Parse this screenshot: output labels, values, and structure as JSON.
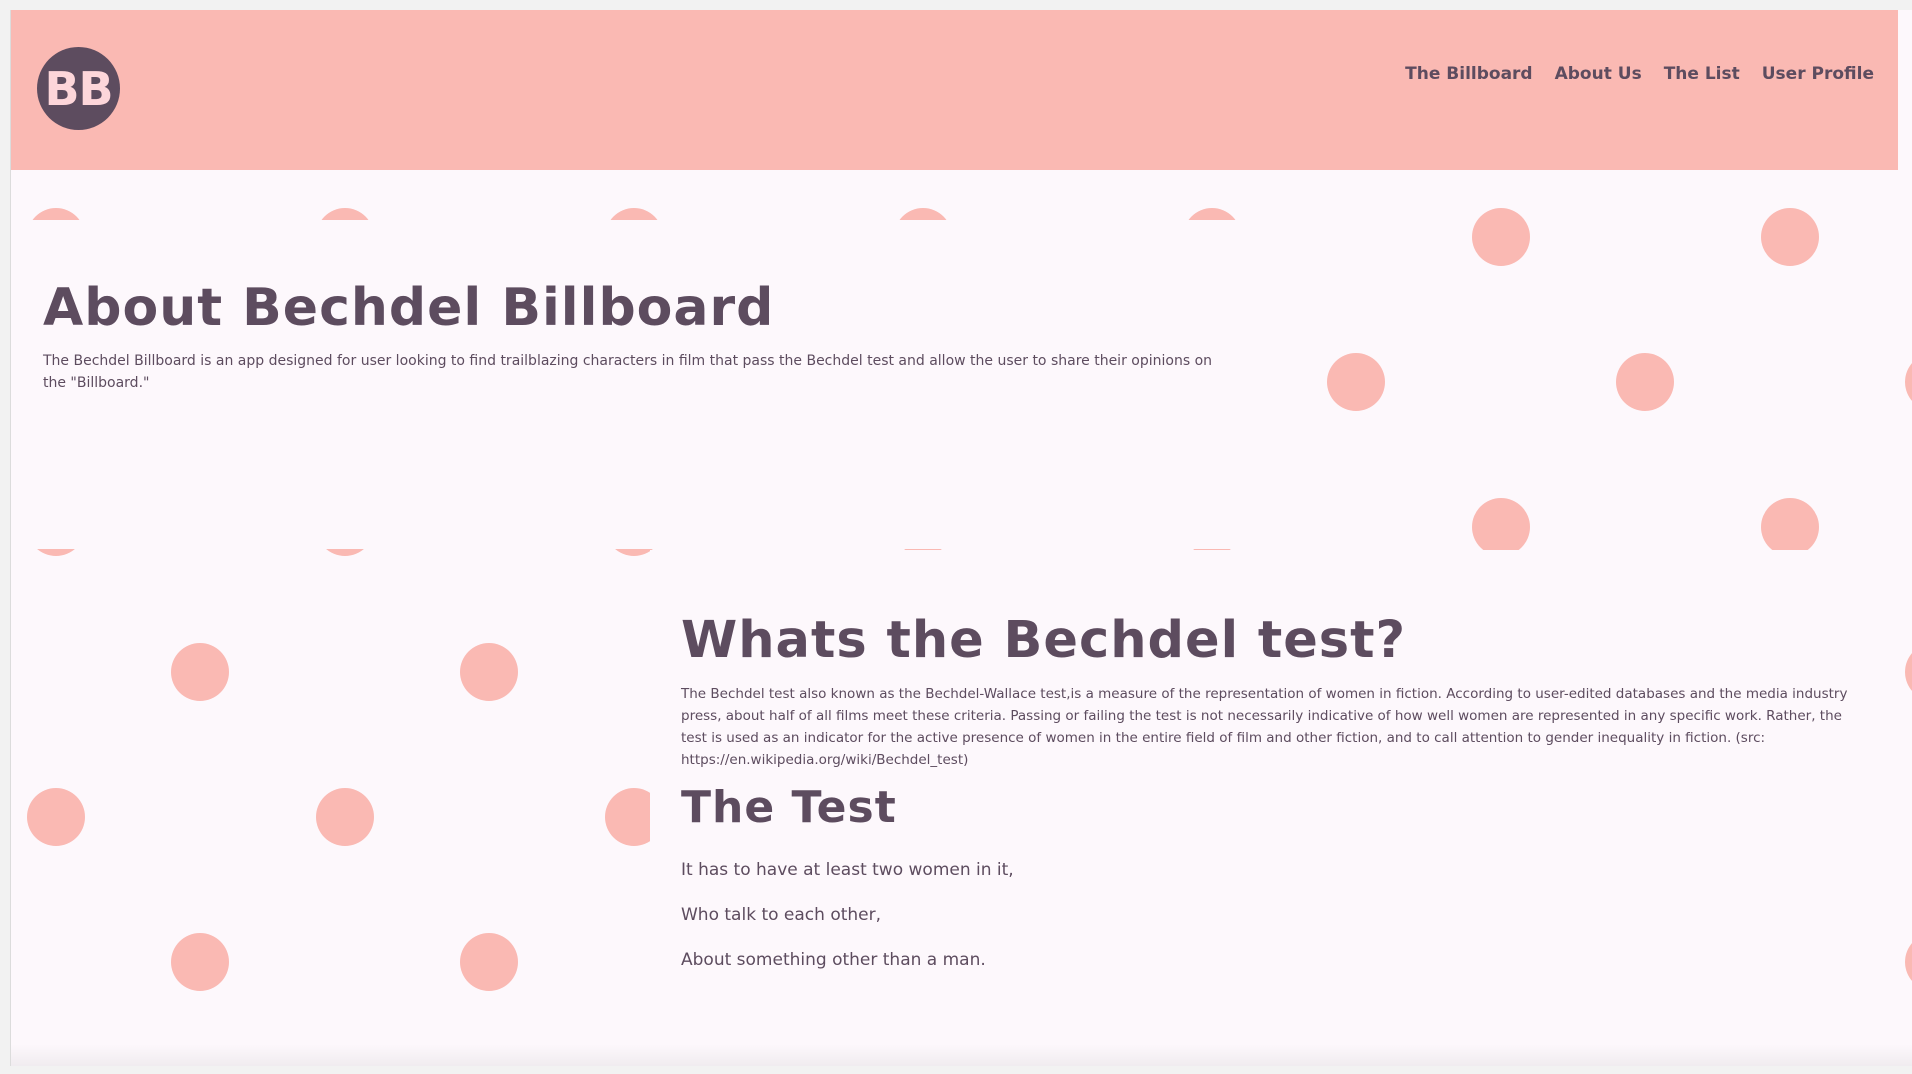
{
  "header": {
    "logo_text": "BB",
    "nav": [
      {
        "label": "The Billboard"
      },
      {
        "label": "About Us"
      },
      {
        "label": "The List"
      },
      {
        "label": "User Profile"
      }
    ]
  },
  "about": {
    "title": "About Bechdel Billboard",
    "description": "The Bechdel Billboard is an app designed for user looking to find trailblazing characters in film that pass the Bechdel test and allow the user to share their opinions on the \"Billboard.\""
  },
  "bechdel": {
    "title": "Whats the Bechdel test?",
    "description": "The Bechdel test also known as the Bechdel-Wallace test,is a measure of the representation of women in fiction. According to user-edited databases and the media industry press, about half of all films meet these criteria. Passing or failing the test is not necessarily indicative of how well women are represented in any specific work. Rather, the test is used as an indicator for the active presence of women in the entire field of film and other fiction, and to call attention to gender inequality in fiction. (src: https://en.wikipedia.org/wiki/Bechdel_test)"
  },
  "test": {
    "title": "The Test",
    "rules": [
      "It has to have at least two women in it,",
      "Who talk to each other,",
      "About something other than a man."
    ]
  },
  "colors": {
    "header_bg": "#fab9b3",
    "dot": "#fab9b3",
    "text": "#5d4c5f",
    "page_bg": "#fdf8fc"
  }
}
